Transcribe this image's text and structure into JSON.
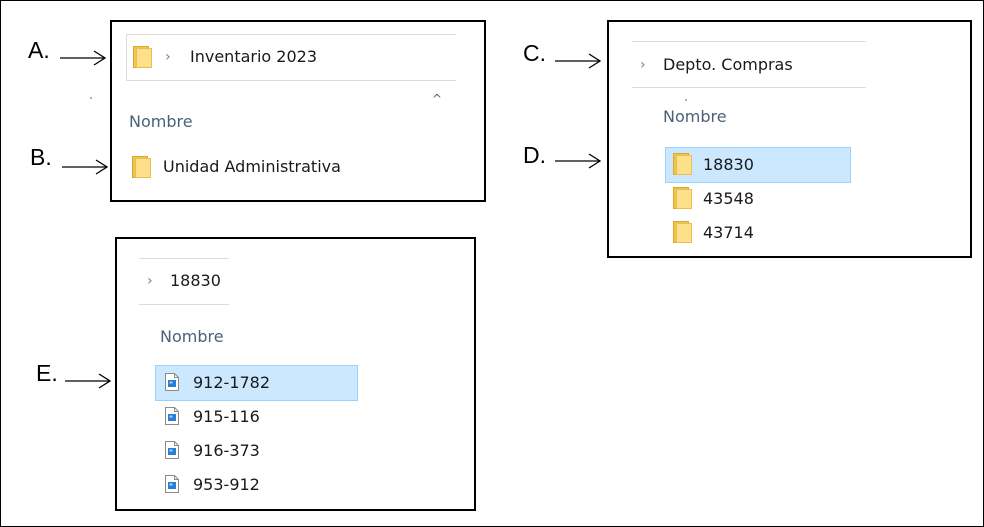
{
  "labels": {
    "a": "A.",
    "b": "B.",
    "c": "C.",
    "d": "D.",
    "e": "E."
  },
  "panel1": {
    "breadcrumb": "Inventario 2023",
    "breadcrumb_chevron": "›",
    "sort_caret": "^",
    "column_header": "Nombre",
    "item": "Unidad Administrativa",
    "folder_icon": "folder-icon"
  },
  "panel2": {
    "breadcrumb": "Depto. Compras",
    "breadcrumb_chevron": "›",
    "column_header": "Nombre",
    "items": [
      "18830",
      "43548",
      "43714"
    ],
    "selected_index": 0
  },
  "panel3": {
    "breadcrumb": "18830",
    "breadcrumb_chevron": "›",
    "column_header": "Nombre",
    "items": [
      "912-1782",
      "915-116",
      "916-373",
      "953-912"
    ],
    "selected_index": 0,
    "file_icon": "image-file-icon"
  },
  "colors": {
    "selection_bg": "#cce8ff",
    "selection_border": "#99d1ff",
    "header_text": "#4c607a",
    "folder_front": "#ffe08a",
    "folder_back": "#f0c54a",
    "file_accent": "#2a7fd4"
  }
}
